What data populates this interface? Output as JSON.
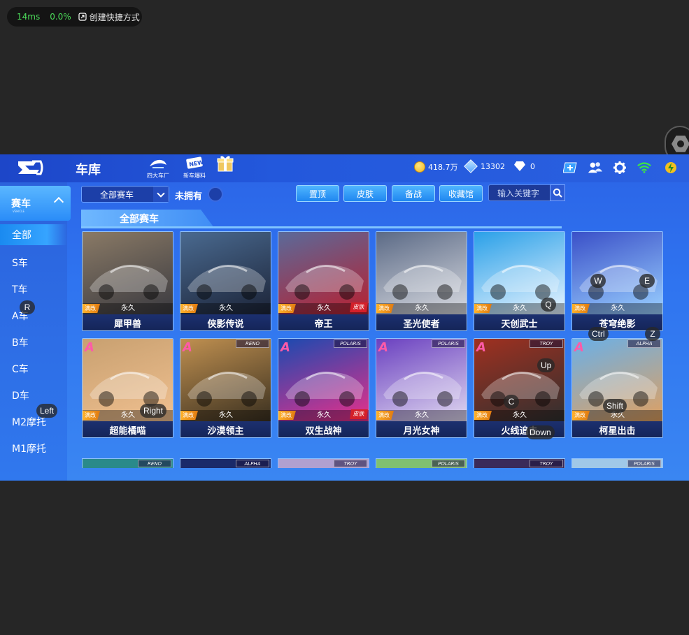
{
  "overlay": {
    "latency": "14ms",
    "cpu": "0.0%",
    "shortcut_label": "创建快捷方式"
  },
  "header": {
    "title": "车库",
    "icons": [
      {
        "name": "四大车厂",
        "icon": "car-factory-icon"
      },
      {
        "name": "新车爆料",
        "icon": "new-car-news-icon"
      },
      {
        "name": "",
        "icon": "gift-icon"
      }
    ],
    "coins": "418.7万",
    "coupons": "13302",
    "diamonds": "0"
  },
  "sidebar": {
    "head": "赛车",
    "head_sub": "VEHICLE",
    "items": [
      "全部",
      "S车",
      "T车",
      "A车",
      "B车",
      "C车",
      "D车",
      "M2摩托",
      "M1摩托"
    ],
    "active_index": 0
  },
  "filters": {
    "dropdown_value": "全部赛车",
    "unowned_label": "未拥有",
    "buttons": [
      "置顶",
      "皮肤",
      "备战",
      "收藏馆"
    ],
    "search_placeholder": "输入关键字"
  },
  "section_title": "全部赛车",
  "cards": [
    {
      "name": "犀甲兽",
      "mod": "满改",
      "perm": "永久",
      "skin": "",
      "brand": "",
      "a": false,
      "colors": [
        "#8a7a66",
        "#3a3a40"
      ]
    },
    {
      "name": "侠影传说",
      "mod": "满改",
      "perm": "永久",
      "skin": "",
      "brand": "",
      "a": false,
      "colors": [
        "#4a6a90",
        "#1c2438"
      ]
    },
    {
      "name": "帝王",
      "mod": "满改",
      "perm": "永久",
      "skin": "皮肤",
      "brand": "",
      "a": false,
      "colors": [
        "#5a6a9a",
        "#b82030"
      ]
    },
    {
      "name": "圣光使者",
      "mod": "满改",
      "perm": "永久",
      "skin": "",
      "brand": "",
      "a": false,
      "colors": [
        "#5b6a86",
        "#d8dae0"
      ]
    },
    {
      "name": "天创武士",
      "mod": "满改",
      "perm": "永久",
      "skin": "",
      "brand": "",
      "a": false,
      "colors": [
        "#2aa0e8",
        "#e8f4ff"
      ]
    },
    {
      "name": "苍穹绝影",
      "mod": "满改",
      "perm": "永久",
      "skin": "",
      "brand": "",
      "a": false,
      "colors": [
        "#3a50c8",
        "#9ad0ff"
      ]
    },
    {
      "name": "超能橘喵",
      "mod": "满改",
      "perm": "永久",
      "skin": "",
      "brand": "",
      "a": true,
      "colors": [
        "#c8a070",
        "#f0c090"
      ]
    },
    {
      "name": "沙漠领主",
      "mod": "满改",
      "perm": "永久",
      "skin": "",
      "brand": "RENO",
      "a": true,
      "colors": [
        "#c09050",
        "#3a3020"
      ]
    },
    {
      "name": "双生战神",
      "mod": "满改",
      "perm": "永久",
      "skin": "皮肤",
      "brand": "POLARIS",
      "a": true,
      "colors": [
        "#1a4ab0",
        "#e8308a"
      ]
    },
    {
      "name": "月光女神",
      "mod": "满改",
      "perm": "永久",
      "skin": "",
      "brand": "POLARIS",
      "a": true,
      "colors": [
        "#6a40c0",
        "#e0d8f0"
      ]
    },
    {
      "name": "火线追击",
      "mod": "满改",
      "perm": "永久",
      "skin": "",
      "brand": "TROY",
      "a": true,
      "colors": [
        "#a03020",
        "#303030"
      ]
    },
    {
      "name": "柯星出击",
      "mod": "满改",
      "perm": "永久",
      "skin": "",
      "brand": "ALPHA",
      "a": true,
      "colors": [
        "#6ab0e8",
        "#e0a060"
      ]
    }
  ],
  "peek_brands": [
    "RENO",
    "ALPHA",
    "TROY",
    "POLARIS",
    "TROY",
    "POLARIS"
  ],
  "key_hints": [
    "R",
    "Left",
    "W",
    "E",
    "Q",
    "Ctrl",
    "Z",
    "Up",
    "C",
    "Right",
    "Shift",
    "Down"
  ]
}
